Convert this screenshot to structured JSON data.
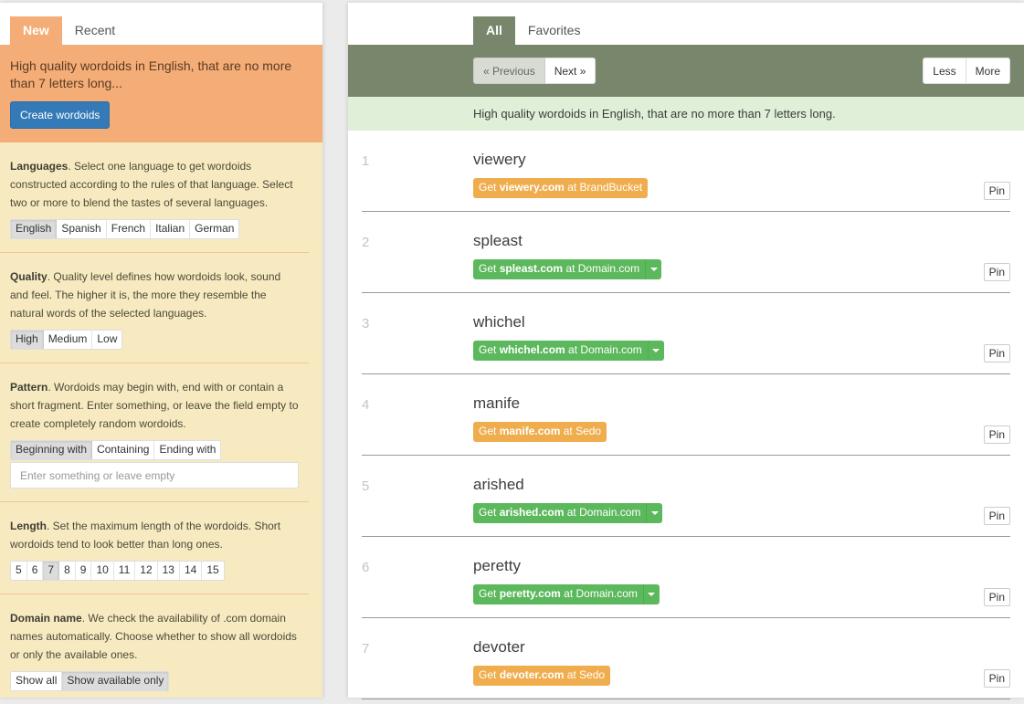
{
  "left": {
    "tabs": [
      {
        "label": "New",
        "active": true
      },
      {
        "label": "Recent",
        "active": false
      }
    ],
    "hero_text": "High quality wordoids in English, that are no more than 7 letters long...",
    "create_button": "Create wordoids",
    "languages": {
      "title": "Languages",
      "description": ". Select one language to get wordoids constructed according to the rules of that language. Select two or more to blend the tastes of several languages.",
      "options": [
        "English",
        "Spanish",
        "French",
        "Italian",
        "German"
      ],
      "selected": [
        "English"
      ]
    },
    "quality": {
      "title": "Quality",
      "description": ". Quality level defines how wordoids look, sound and feel. The higher it is, the more they resemble the natural words of the selected languages.",
      "options": [
        "High",
        "Medium",
        "Low"
      ],
      "selected": "High"
    },
    "pattern": {
      "title": "Pattern",
      "description": ". Wordoids may begin with, end with or contain a short fragment. Enter something, or leave the field empty to create completely random wordoids.",
      "options": [
        "Beginning with",
        "Containing",
        "Ending with"
      ],
      "selected": "Beginning with",
      "input_value": "",
      "input_placeholder": "Enter something or leave empty"
    },
    "length": {
      "title": "Length",
      "description": ". Set the maximum length of the wordoids. Short wordoids tend to look better than long ones.",
      "options": [
        "5",
        "6",
        "7",
        "8",
        "9",
        "10",
        "11",
        "12",
        "13",
        "14",
        "15"
      ],
      "selected": "7"
    },
    "domain": {
      "title": "Domain name",
      "description": ". We check the availability of .com domain names automatically. Choose whether to show all wordoids or only the available ones.",
      "options": [
        "Show all",
        "Show available only"
      ],
      "selected": "Show available only"
    }
  },
  "right": {
    "tabs": [
      {
        "label": "All",
        "active": true
      },
      {
        "label": "Favorites",
        "active": false
      }
    ],
    "previous": "« Previous",
    "next": "Next »",
    "less": "Less",
    "more": "More",
    "summary": "High quality wordoids in English, that are no more than 7 letters long.",
    "pin_label": "Pin",
    "results": [
      {
        "num": "1",
        "word": "viewery",
        "domain": "viewery.com",
        "registrar": "BrandBucket",
        "color": "orange",
        "dropdown": false
      },
      {
        "num": "2",
        "word": "spleast",
        "domain": "spleast.com",
        "registrar": "Domain.com",
        "color": "green",
        "dropdown": true
      },
      {
        "num": "3",
        "word": "whichel",
        "domain": "whichel.com",
        "registrar": "Domain.com",
        "color": "green",
        "dropdown": true
      },
      {
        "num": "4",
        "word": "manife",
        "domain": "manife.com",
        "registrar": "Sedo",
        "color": "orange",
        "dropdown": false
      },
      {
        "num": "5",
        "word": "arished",
        "domain": "arished.com",
        "registrar": "Domain.com",
        "color": "green",
        "dropdown": true
      },
      {
        "num": "6",
        "word": "peretty",
        "domain": "peretty.com",
        "registrar": "Domain.com",
        "color": "green",
        "dropdown": true
      },
      {
        "num": "7",
        "word": "devoter",
        "domain": "devoter.com",
        "registrar": "Sedo",
        "color": "orange",
        "dropdown": false
      }
    ],
    "get_prefix": "Get ",
    "get_mid": " at "
  },
  "colors": {
    "left_accent": "#f4ad76",
    "left_bg": "#f8eac0",
    "right_accent": "#78866b",
    "summary_bg": "#dfefd8",
    "primary_button": "#337ab7",
    "orange_button": "#f0ad4e",
    "green_button": "#5cb85c"
  }
}
